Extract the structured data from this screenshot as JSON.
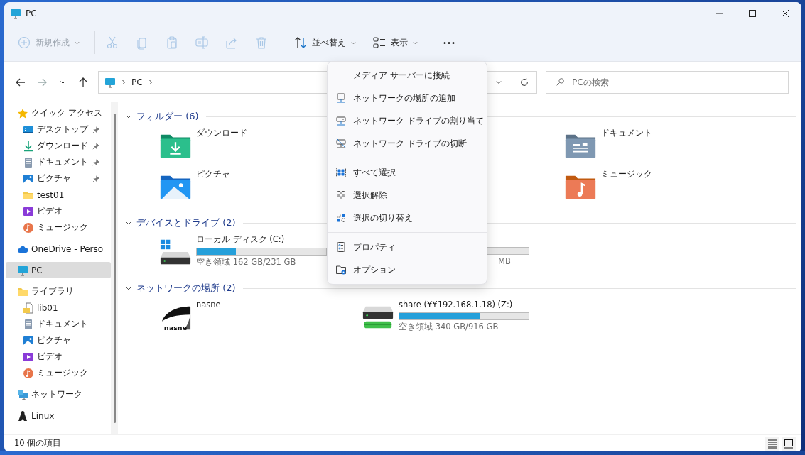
{
  "window": {
    "title": "PC"
  },
  "toolbar": [
    {
      "buttons": [
        {
          "kind": "new",
          "label": "新規作成",
          "disabled": true,
          "dropdown": true
        }
      ]
    },
    {
      "buttons": [
        {
          "kind": "cut",
          "disabled": true,
          "dropdown": false
        },
        {
          "kind": "copy",
          "disabled": true,
          "dropdown": false
        },
        {
          "kind": "paste",
          "disabled": true,
          "dropdown": false
        },
        {
          "kind": "rename",
          "disabled": true,
          "dropdown": false
        },
        {
          "kind": "share",
          "disabled": true,
          "dropdown": false
        },
        {
          "kind": "delete",
          "disabled": true,
          "dropdown": false
        }
      ]
    },
    {
      "buttons": [
        {
          "kind": "sort",
          "label": "並べ替え",
          "disabled": false,
          "dropdown": true
        },
        {
          "kind": "view",
          "label": "表示",
          "disabled": false,
          "dropdown": true
        }
      ]
    },
    {
      "buttons": [
        {
          "kind": "more",
          "disabled": false,
          "dropdown": false
        }
      ]
    }
  ],
  "navigation": {
    "back_disabled": false,
    "forward_disabled": true
  },
  "address": {
    "path": [
      "PC"
    ]
  },
  "search": {
    "placeholder": "PCの検索"
  },
  "sidebar": {
    "items": [
      {
        "kind": "quick_access",
        "label": "クイック アクセス",
        "selected": false,
        "children": [
          {
            "kind": "desktop",
            "label": "デスクトップ",
            "pinned": true,
            "selected": false
          },
          {
            "kind": "download",
            "label": "ダウンロード",
            "pinned": true,
            "selected": false
          },
          {
            "kind": "document",
            "label": "ドキュメント",
            "pinned": true,
            "selected": false
          },
          {
            "kind": "picture",
            "label": "ピクチャ",
            "pinned": true,
            "selected": false
          },
          {
            "kind": "folder",
            "label": "test01",
            "pinned": false,
            "selected": false
          },
          {
            "kind": "video",
            "label": "ビデオ",
            "pinned": false,
            "selected": false
          },
          {
            "kind": "music",
            "label": "ミュージック",
            "pinned": false,
            "selected": false
          }
        ]
      },
      {
        "kind": "cloud",
        "label": "OneDrive - Perso",
        "selected": false
      },
      {
        "kind": "pc",
        "label": "PC",
        "selected": true
      },
      {
        "kind": "folder",
        "label": "ライブラリ",
        "selected": false,
        "children": [
          {
            "kind": "library_file",
            "label": "lib01",
            "pinned": false,
            "selected": false
          },
          {
            "kind": "document",
            "label": "ドキュメント",
            "pinned": false,
            "selected": false
          },
          {
            "kind": "picture",
            "label": "ピクチャ",
            "pinned": false,
            "selected": false
          },
          {
            "kind": "video",
            "label": "ビデオ",
            "pinned": false,
            "selected": false
          },
          {
            "kind": "music",
            "label": "ミュージック",
            "pinned": false,
            "selected": false
          }
        ]
      },
      {
        "kind": "network",
        "label": "ネットワーク",
        "selected": false
      },
      {
        "kind": "linux",
        "label": "Linux",
        "selected": false
      }
    ]
  },
  "sections": [
    {
      "title": "フォルダー (6)",
      "expanded": true,
      "items": [
        {
          "kind": "download_folder",
          "name": "ダウンロード"
        },
        {
          "kind": "covered"
        },
        {
          "kind": "documents_folder",
          "name": "ドキュメント"
        },
        {
          "kind": "pictures_folder",
          "name": "ピクチャ"
        },
        {
          "kind": "covered"
        },
        {
          "kind": "music_folder",
          "name": "ミュージック"
        }
      ]
    },
    {
      "title": "デバイスとドライブ (2)",
      "expanded": true,
      "items": [
        {
          "kind": "system_drive",
          "name": "ローカル ディスク (C:)",
          "level": 0.3,
          "free": "空き領域 162 GB/231 GB"
        },
        {
          "kind": "partial_drive",
          "free": "MB"
        }
      ]
    },
    {
      "title": "ネットワークの場所 (2)",
      "expanded": true,
      "items": [
        {
          "kind": "nasne",
          "name": "nasne",
          "logo_text": "nasne"
        },
        {
          "kind": "network_drive",
          "name": "share (¥¥192.168.1.18) (Z:)",
          "level": 0.62,
          "free": "空き領域 340 GB/916 GB"
        }
      ]
    }
  ],
  "menu": {
    "groups": [
      {
        "items": [
          {
            "kind": "media_server",
            "label": "メディア サーバーに接続"
          },
          {
            "kind": "add_location",
            "label": "ネットワークの場所の追加"
          },
          {
            "kind": "map_drive",
            "label": "ネットワーク ドライブの割り当て"
          },
          {
            "kind": "disconnect_drive",
            "label": "ネットワーク ドライブの切断"
          }
        ]
      },
      {
        "items": [
          {
            "kind": "select_all",
            "label": "すべて選択"
          },
          {
            "kind": "select_none",
            "label": "選択解除"
          },
          {
            "kind": "select_invert",
            "label": "選択の切り替え"
          }
        ]
      },
      {
        "items": [
          {
            "kind": "properties",
            "label": "プロパティ"
          },
          {
            "kind": "options",
            "label": "オプション"
          }
        ]
      }
    ]
  },
  "status_bar": {
    "count": "10 個の項目"
  }
}
